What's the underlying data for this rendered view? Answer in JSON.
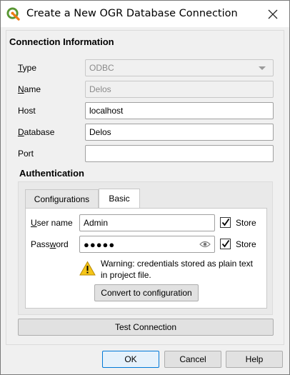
{
  "window": {
    "title": "Create a New OGR Database Connection",
    "close_glyph": "✕"
  },
  "connection": {
    "section_title": "Connection Information",
    "type_label_u": "T",
    "type_label_rest": "ype",
    "type_value": "ODBC",
    "name_label_u": "N",
    "name_label_rest": "ame",
    "name_value": "Delos",
    "host_label": "Host",
    "host_value": "localhost",
    "database_label_u": "D",
    "database_label_rest": "atabase",
    "database_value": "Delos",
    "port_label": "Port",
    "port_value": ""
  },
  "authentication": {
    "section_title": "Authentication",
    "tabs": [
      {
        "label": "Configurations",
        "active": false
      },
      {
        "label": "Basic",
        "active": true
      }
    ],
    "username_label_u": "U",
    "username_label_rest": "ser name",
    "username_value": "Admin",
    "password_label_pre": "Pass",
    "password_label_u": "w",
    "password_label_rest": "ord",
    "password_value": "●●●●●",
    "store_label": "Store",
    "store_username_checked": true,
    "store_password_checked": true,
    "warning_text": "Warning: credentials stored as plain text in project file.",
    "convert_button": "Convert to configuration"
  },
  "test_button_u": "T",
  "test_button_rest": "est Connection",
  "footer": {
    "ok": "OK",
    "cancel": "Cancel",
    "help": "Help"
  },
  "icons": {
    "app": "qgis-icon",
    "warning": "warning-icon",
    "eye": "eye-icon",
    "close": "close-icon"
  },
  "colors": {
    "accent": "#0078d7",
    "qgis_green": "#589632",
    "qgis_yellow": "#ee7913",
    "warning_yellow": "#f5c518"
  }
}
